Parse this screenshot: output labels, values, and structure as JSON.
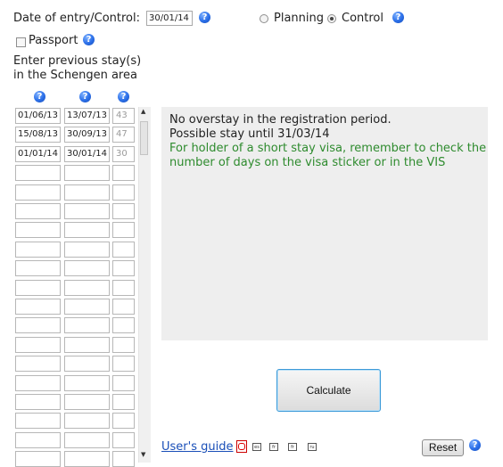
{
  "header": {
    "date_label": "Date of entry/Control:",
    "date_value": "30/01/14",
    "mode_options": [
      {
        "label": "Planning",
        "selected": false
      },
      {
        "label": "Control",
        "selected": true
      }
    ],
    "passport_label": "Passport",
    "passport_checked": false
  },
  "instructions": {
    "line1": "Enter previous stay(s)",
    "line2": "in the Schengen area"
  },
  "stays": [
    {
      "entry": "01/06/13",
      "exit": "13/07/13",
      "days": "43"
    },
    {
      "entry": "15/08/13",
      "exit": "30/09/13",
      "days": "47"
    },
    {
      "entry": "01/01/14",
      "exit": "30/01/14",
      "days": "30"
    },
    {
      "entry": "",
      "exit": "",
      "days": ""
    },
    {
      "entry": "",
      "exit": "",
      "days": ""
    },
    {
      "entry": "",
      "exit": "",
      "days": ""
    },
    {
      "entry": "",
      "exit": "",
      "days": ""
    },
    {
      "entry": "",
      "exit": "",
      "days": ""
    },
    {
      "entry": "",
      "exit": "",
      "days": ""
    },
    {
      "entry": "",
      "exit": "",
      "days": ""
    },
    {
      "entry": "",
      "exit": "",
      "days": ""
    },
    {
      "entry": "",
      "exit": "",
      "days": ""
    },
    {
      "entry": "",
      "exit": "",
      "days": ""
    },
    {
      "entry": "",
      "exit": "",
      "days": ""
    },
    {
      "entry": "",
      "exit": "",
      "days": ""
    },
    {
      "entry": "",
      "exit": "",
      "days": ""
    },
    {
      "entry": "",
      "exit": "",
      "days": ""
    },
    {
      "entry": "",
      "exit": "",
      "days": ""
    },
    {
      "entry": "",
      "exit": "",
      "days": ""
    }
  ],
  "result": {
    "line1": "No overstay in the registration period.",
    "line2": "Possible stay until 31/03/14",
    "note": "For holder of a short stay visa, remember to check the number of days on the visa sticker or in the VIS",
    "note_color": "#2e8b2e"
  },
  "actions": {
    "calculate_label": "Calculate",
    "reset_label": "Reset",
    "guide_label": "User's guide",
    "languages": [
      "es",
      "fr",
      "fr",
      "ru"
    ],
    "link_color": "#1a4fb8"
  },
  "icons": {
    "help": "help-icon",
    "pdf": "pdf-icon"
  }
}
